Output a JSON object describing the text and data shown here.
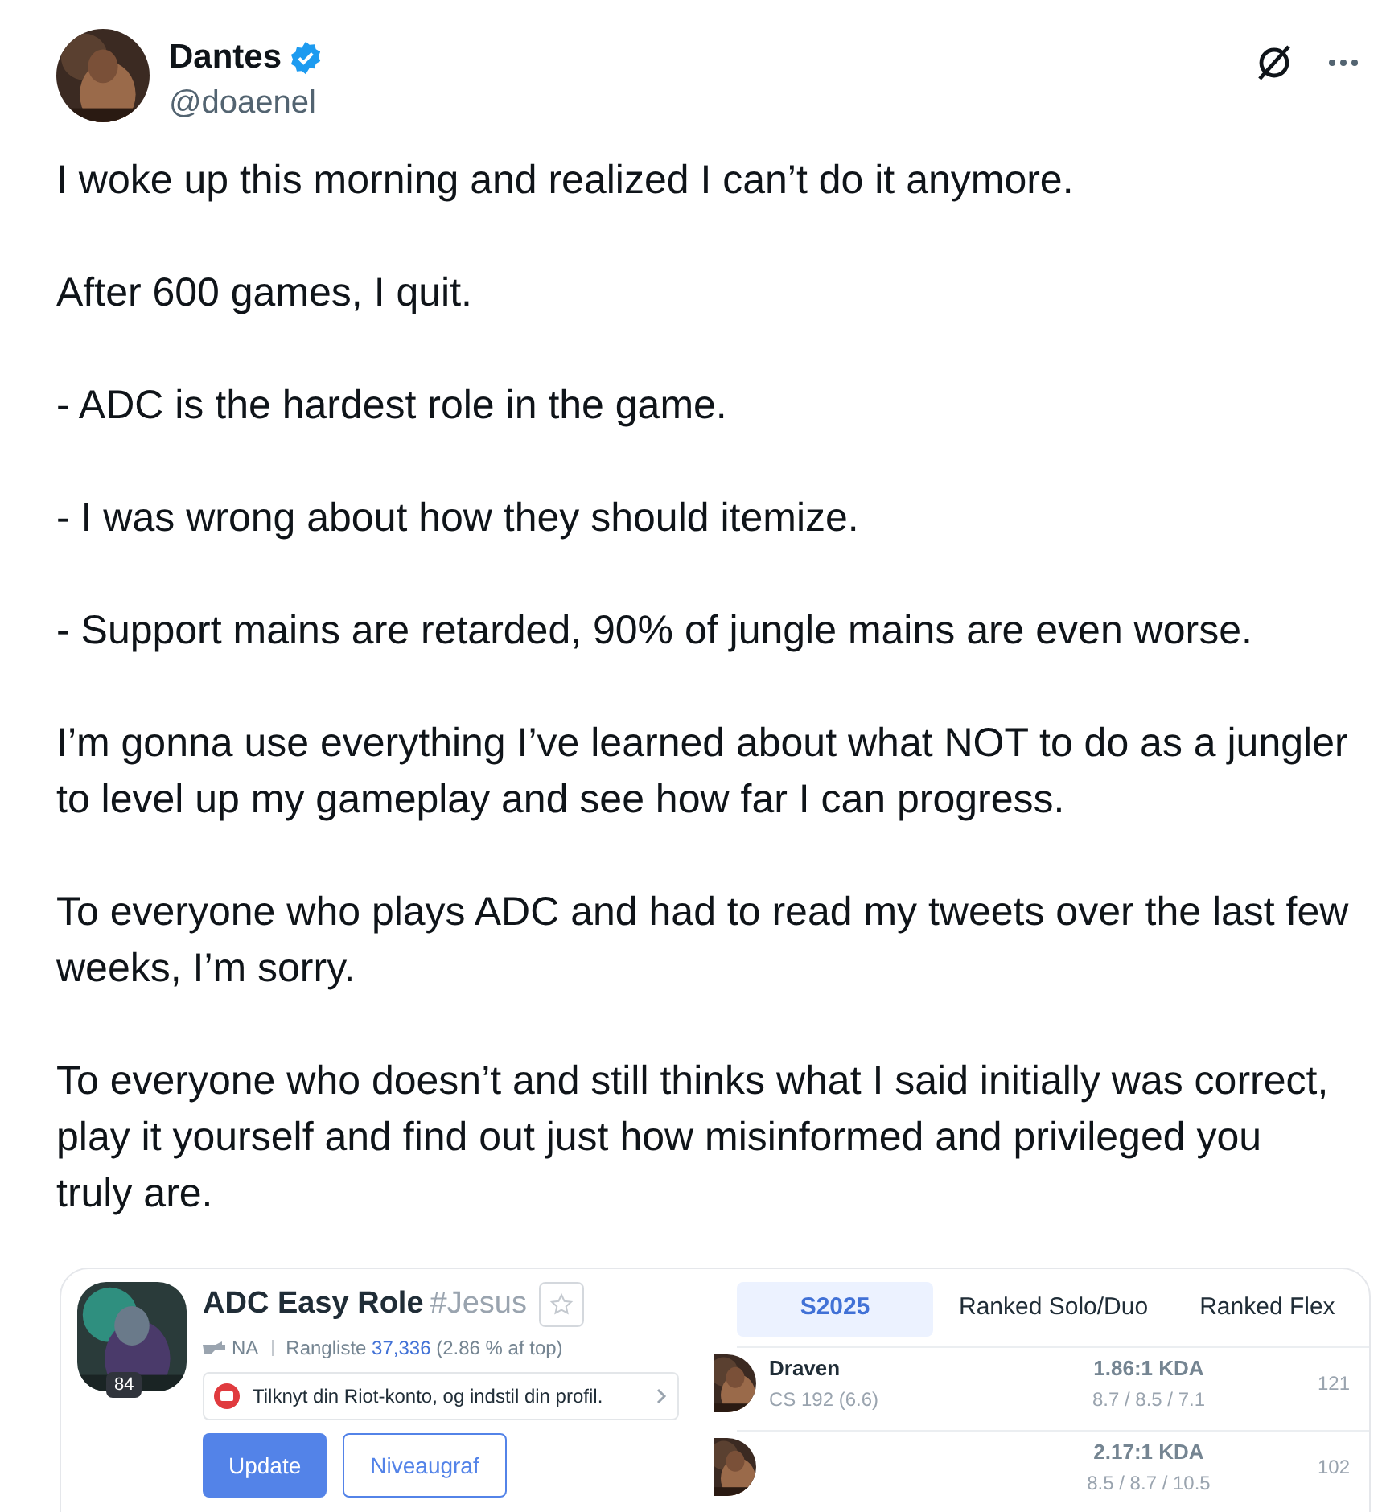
{
  "author": {
    "name": "Dantes",
    "verified": true,
    "handle": "@doaenel"
  },
  "paragraphs": [
    [
      "I woke up this morning and realized I can’t do it anymore."
    ],
    [
      "After 600 games, I quit."
    ],
    [
      "- ADC is the hardest role in the game."
    ],
    [
      "- I was wrong about how they should itemize."
    ],
    [
      "- Support mains are retarded, 90% of jungle mains are even worse."
    ],
    [
      "I’m gonna use everything I’ve learned about what NOT to do as a jungler",
      "to level up my gameplay and see how far I can progress."
    ],
    [
      "To everyone who plays ADC and had to read my tweets over the last few",
      "weeks, I’m sorry."
    ],
    [
      "To everyone who doesn’t and still thinks what I said initially was correct,",
      "play it yourself and find out just how misinformed and privileged you",
      "truly are."
    ]
  ],
  "embed": {
    "profile": {
      "name": "ADC Easy Role",
      "tag": "#Jesus",
      "level": "84",
      "region": "NA",
      "rank_label": "Rangliste",
      "rank_value": "37,336",
      "rank_share": "(2.86 % af top)",
      "notice": "Tilknyt din Riot-konto, og indstil din profil.",
      "buttons": [
        {
          "label": "Update",
          "kind": "primary"
        },
        {
          "label": "Niveaugraf",
          "kind": "outline"
        }
      ]
    },
    "tabs": [
      {
        "label": "S2025",
        "selected": true
      },
      {
        "label": "Ranked Solo/Duo",
        "selected": false
      },
      {
        "label": "Ranked Flex",
        "selected": false
      }
    ],
    "matches": [
      {
        "champion": "Draven",
        "cs": "CS 192 (6.6)",
        "kda": "1.86:1 KDA",
        "score": "8.7 / 8.5 / 7.1",
        "column_4": "121"
      },
      {
        "kda": "2.17:1 KDA",
        "score": "8.5 / 8.7 / 10.5",
        "column_4": "102"
      }
    ]
  }
}
